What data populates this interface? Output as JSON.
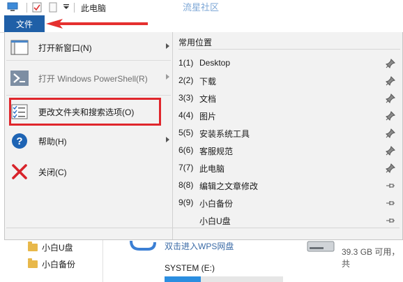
{
  "titlebar": {
    "title": "此电脑",
    "watermark": "流星社区"
  },
  "ribbon": {
    "file_tab": "文件"
  },
  "file_menu": {
    "items": [
      {
        "label": "打开新窗口(N)",
        "icon": "new-window-icon",
        "has_submenu": true,
        "disabled": false
      },
      {
        "label": "打开 Windows PowerShell(R)",
        "icon": "powershell-icon",
        "has_submenu": true,
        "disabled": true
      },
      {
        "label": "更改文件夹和搜索选项(O)",
        "icon": "folder-options-icon",
        "has_submenu": false,
        "disabled": false,
        "highlighted": true
      },
      {
        "label": "帮助(H)",
        "icon": "help-icon",
        "has_submenu": true,
        "disabled": false
      },
      {
        "label": "关闭(C)",
        "icon": "close-icon",
        "has_submenu": false,
        "disabled": false
      }
    ],
    "recent": {
      "header": "常用位置",
      "items": [
        {
          "num": "1(1)",
          "name": "Desktop",
          "pinned": true
        },
        {
          "num": "2(2)",
          "name": "下载",
          "pinned": true
        },
        {
          "num": "3(3)",
          "name": "文档",
          "pinned": true
        },
        {
          "num": "4(4)",
          "name": "图片",
          "pinned": true
        },
        {
          "num": "5(5)",
          "name": "安装系统工具",
          "pinned": true
        },
        {
          "num": "6(6)",
          "name": "客服规范",
          "pinned": true
        },
        {
          "num": "7(7)",
          "name": "此电脑",
          "pinned": true
        },
        {
          "num": "8(8)",
          "name": "编辑之文章修改",
          "pinned": false
        },
        {
          "num": "9(9)",
          "name": "小白备份",
          "pinned": false
        },
        {
          "num": "",
          "name": "小白U盘",
          "pinned": false
        }
      ]
    }
  },
  "background": {
    "nav_items": [
      "小白U盘",
      "小白备份"
    ],
    "wps_text": "双击进入WPS网盘",
    "drive_free": "39.3 GB 可用，共",
    "drive_label": "SYSTEM (E:)"
  },
  "colors": {
    "file_tab": "#1f5fa7",
    "highlight_red": "#e0262c",
    "menu_bg": "#f2f2f2"
  }
}
